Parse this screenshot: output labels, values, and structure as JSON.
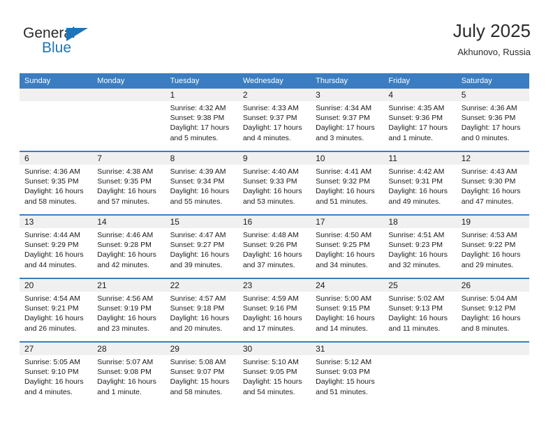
{
  "brand": {
    "name_part1": "General",
    "name_part2": "Blue",
    "triangle_color": "#1b75bb"
  },
  "header": {
    "title": "July 2025",
    "location": "Akhunovo, Russia"
  },
  "calendar": {
    "weekdays": [
      "Sunday",
      "Monday",
      "Tuesday",
      "Wednesday",
      "Thursday",
      "Friday",
      "Saturday"
    ],
    "header_bg": "#3b7dc0",
    "daynum_bg": "#f0f0f0",
    "weeks": [
      [
        {
          "day": "",
          "sunrise": "",
          "sunset": "",
          "daylight1": "",
          "daylight2": ""
        },
        {
          "day": "",
          "sunrise": "",
          "sunset": "",
          "daylight1": "",
          "daylight2": ""
        },
        {
          "day": "1",
          "sunrise": "Sunrise: 4:32 AM",
          "sunset": "Sunset: 9:38 PM",
          "daylight1": "Daylight: 17 hours",
          "daylight2": "and 5 minutes."
        },
        {
          "day": "2",
          "sunrise": "Sunrise: 4:33 AM",
          "sunset": "Sunset: 9:37 PM",
          "daylight1": "Daylight: 17 hours",
          "daylight2": "and 4 minutes."
        },
        {
          "day": "3",
          "sunrise": "Sunrise: 4:34 AM",
          "sunset": "Sunset: 9:37 PM",
          "daylight1": "Daylight: 17 hours",
          "daylight2": "and 3 minutes."
        },
        {
          "day": "4",
          "sunrise": "Sunrise: 4:35 AM",
          "sunset": "Sunset: 9:36 PM",
          "daylight1": "Daylight: 17 hours",
          "daylight2": "and 1 minute."
        },
        {
          "day": "5",
          "sunrise": "Sunrise: 4:36 AM",
          "sunset": "Sunset: 9:36 PM",
          "daylight1": "Daylight: 17 hours",
          "daylight2": "and 0 minutes."
        }
      ],
      [
        {
          "day": "6",
          "sunrise": "Sunrise: 4:36 AM",
          "sunset": "Sunset: 9:35 PM",
          "daylight1": "Daylight: 16 hours",
          "daylight2": "and 58 minutes."
        },
        {
          "day": "7",
          "sunrise": "Sunrise: 4:38 AM",
          "sunset": "Sunset: 9:35 PM",
          "daylight1": "Daylight: 16 hours",
          "daylight2": "and 57 minutes."
        },
        {
          "day": "8",
          "sunrise": "Sunrise: 4:39 AM",
          "sunset": "Sunset: 9:34 PM",
          "daylight1": "Daylight: 16 hours",
          "daylight2": "and 55 minutes."
        },
        {
          "day": "9",
          "sunrise": "Sunrise: 4:40 AM",
          "sunset": "Sunset: 9:33 PM",
          "daylight1": "Daylight: 16 hours",
          "daylight2": "and 53 minutes."
        },
        {
          "day": "10",
          "sunrise": "Sunrise: 4:41 AM",
          "sunset": "Sunset: 9:32 PM",
          "daylight1": "Daylight: 16 hours",
          "daylight2": "and 51 minutes."
        },
        {
          "day": "11",
          "sunrise": "Sunrise: 4:42 AM",
          "sunset": "Sunset: 9:31 PM",
          "daylight1": "Daylight: 16 hours",
          "daylight2": "and 49 minutes."
        },
        {
          "day": "12",
          "sunrise": "Sunrise: 4:43 AM",
          "sunset": "Sunset: 9:30 PM",
          "daylight1": "Daylight: 16 hours",
          "daylight2": "and 47 minutes."
        }
      ],
      [
        {
          "day": "13",
          "sunrise": "Sunrise: 4:44 AM",
          "sunset": "Sunset: 9:29 PM",
          "daylight1": "Daylight: 16 hours",
          "daylight2": "and 44 minutes."
        },
        {
          "day": "14",
          "sunrise": "Sunrise: 4:46 AM",
          "sunset": "Sunset: 9:28 PM",
          "daylight1": "Daylight: 16 hours",
          "daylight2": "and 42 minutes."
        },
        {
          "day": "15",
          "sunrise": "Sunrise: 4:47 AM",
          "sunset": "Sunset: 9:27 PM",
          "daylight1": "Daylight: 16 hours",
          "daylight2": "and 39 minutes."
        },
        {
          "day": "16",
          "sunrise": "Sunrise: 4:48 AM",
          "sunset": "Sunset: 9:26 PM",
          "daylight1": "Daylight: 16 hours",
          "daylight2": "and 37 minutes."
        },
        {
          "day": "17",
          "sunrise": "Sunrise: 4:50 AM",
          "sunset": "Sunset: 9:25 PM",
          "daylight1": "Daylight: 16 hours",
          "daylight2": "and 34 minutes."
        },
        {
          "day": "18",
          "sunrise": "Sunrise: 4:51 AM",
          "sunset": "Sunset: 9:23 PM",
          "daylight1": "Daylight: 16 hours",
          "daylight2": "and 32 minutes."
        },
        {
          "day": "19",
          "sunrise": "Sunrise: 4:53 AM",
          "sunset": "Sunset: 9:22 PM",
          "daylight1": "Daylight: 16 hours",
          "daylight2": "and 29 minutes."
        }
      ],
      [
        {
          "day": "20",
          "sunrise": "Sunrise: 4:54 AM",
          "sunset": "Sunset: 9:21 PM",
          "daylight1": "Daylight: 16 hours",
          "daylight2": "and 26 minutes."
        },
        {
          "day": "21",
          "sunrise": "Sunrise: 4:56 AM",
          "sunset": "Sunset: 9:19 PM",
          "daylight1": "Daylight: 16 hours",
          "daylight2": "and 23 minutes."
        },
        {
          "day": "22",
          "sunrise": "Sunrise: 4:57 AM",
          "sunset": "Sunset: 9:18 PM",
          "daylight1": "Daylight: 16 hours",
          "daylight2": "and 20 minutes."
        },
        {
          "day": "23",
          "sunrise": "Sunrise: 4:59 AM",
          "sunset": "Sunset: 9:16 PM",
          "daylight1": "Daylight: 16 hours",
          "daylight2": "and 17 minutes."
        },
        {
          "day": "24",
          "sunrise": "Sunrise: 5:00 AM",
          "sunset": "Sunset: 9:15 PM",
          "daylight1": "Daylight: 16 hours",
          "daylight2": "and 14 minutes."
        },
        {
          "day": "25",
          "sunrise": "Sunrise: 5:02 AM",
          "sunset": "Sunset: 9:13 PM",
          "daylight1": "Daylight: 16 hours",
          "daylight2": "and 11 minutes."
        },
        {
          "day": "26",
          "sunrise": "Sunrise: 5:04 AM",
          "sunset": "Sunset: 9:12 PM",
          "daylight1": "Daylight: 16 hours",
          "daylight2": "and 8 minutes."
        }
      ],
      [
        {
          "day": "27",
          "sunrise": "Sunrise: 5:05 AM",
          "sunset": "Sunset: 9:10 PM",
          "daylight1": "Daylight: 16 hours",
          "daylight2": "and 4 minutes."
        },
        {
          "day": "28",
          "sunrise": "Sunrise: 5:07 AM",
          "sunset": "Sunset: 9:08 PM",
          "daylight1": "Daylight: 16 hours",
          "daylight2": "and 1 minute."
        },
        {
          "day": "29",
          "sunrise": "Sunrise: 5:08 AM",
          "sunset": "Sunset: 9:07 PM",
          "daylight1": "Daylight: 15 hours",
          "daylight2": "and 58 minutes."
        },
        {
          "day": "30",
          "sunrise": "Sunrise: 5:10 AM",
          "sunset": "Sunset: 9:05 PM",
          "daylight1": "Daylight: 15 hours",
          "daylight2": "and 54 minutes."
        },
        {
          "day": "31",
          "sunrise": "Sunrise: 5:12 AM",
          "sunset": "Sunset: 9:03 PM",
          "daylight1": "Daylight: 15 hours",
          "daylight2": "and 51 minutes."
        },
        {
          "day": "",
          "sunrise": "",
          "sunset": "",
          "daylight1": "",
          "daylight2": ""
        },
        {
          "day": "",
          "sunrise": "",
          "sunset": "",
          "daylight1": "",
          "daylight2": ""
        }
      ]
    ]
  }
}
